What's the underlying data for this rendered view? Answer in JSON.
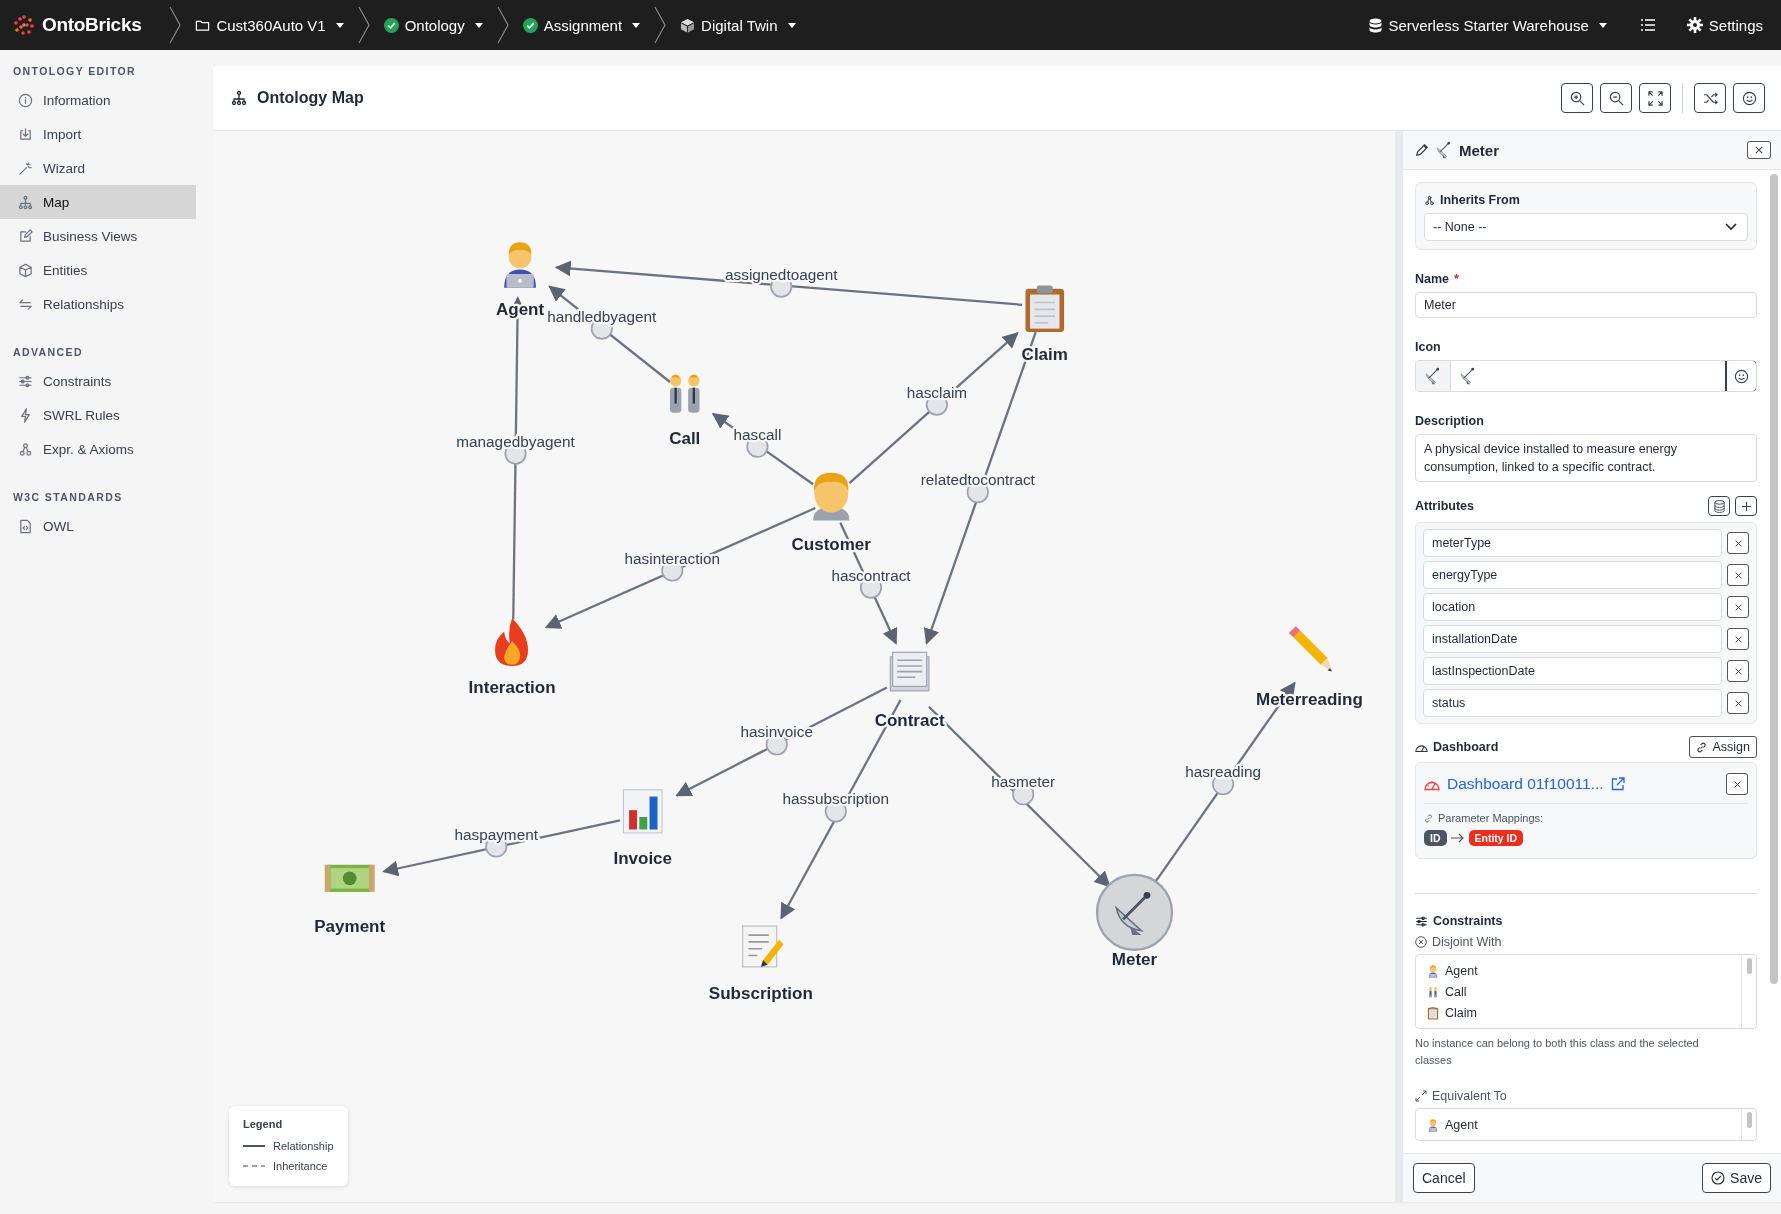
{
  "topbar": {
    "brand": "OntoBricks",
    "breadcrumbs": [
      {
        "label": "Cust360Auto V1",
        "kind": "folder"
      },
      {
        "label": "Ontology",
        "kind": "check"
      },
      {
        "label": "Assignment",
        "kind": "check"
      },
      {
        "label": "Digital Twin",
        "kind": "cube"
      }
    ],
    "warehouse": "Serverless Starter Warehouse",
    "settings": "Settings"
  },
  "sidebar": {
    "sections": [
      {
        "title": "ONTOLOGY EDITOR",
        "items": [
          {
            "label": "Information",
            "kind": "info",
            "selected": false
          },
          {
            "label": "Import",
            "kind": "import",
            "selected": false
          },
          {
            "label": "Wizard",
            "kind": "wand",
            "selected": false
          },
          {
            "label": "Map",
            "kind": "tree",
            "selected": true
          },
          {
            "label": "Business Views",
            "kind": "edit",
            "selected": false
          },
          {
            "label": "Entities",
            "kind": "cube",
            "selected": false
          },
          {
            "label": "Relationships",
            "kind": "arrows",
            "selected": false
          }
        ]
      },
      {
        "title": "ADVANCED",
        "items": [
          {
            "label": "Constraints",
            "kind": "sliders",
            "selected": false
          },
          {
            "label": "SWRL Rules",
            "kind": "bolt",
            "selected": false
          },
          {
            "label": "Expr. & Axioms",
            "kind": "nodes",
            "selected": false
          }
        ]
      },
      {
        "title": "W3C STANDARDS",
        "items": [
          {
            "label": "OWL",
            "kind": "file",
            "selected": false
          }
        ]
      }
    ]
  },
  "map": {
    "title": "Ontology Map",
    "nodes": [
      {
        "label": "Agent",
        "selected": false
      },
      {
        "label": "Call",
        "selected": false
      },
      {
        "label": "Claim",
        "selected": false
      },
      {
        "label": "Customer",
        "selected": false
      },
      {
        "label": "Interaction",
        "selected": false
      },
      {
        "label": "Contract",
        "selected": false
      },
      {
        "label": "Meterreading",
        "selected": false
      },
      {
        "label": "Invoice",
        "selected": false
      },
      {
        "label": "Payment",
        "selected": false
      },
      {
        "label": "Subscription",
        "selected": false
      },
      {
        "label": "Meter",
        "selected": true
      }
    ],
    "edges": [
      {
        "label": "assignedtoagent"
      },
      {
        "label": "handledbyagent"
      },
      {
        "label": "managedbyagent"
      },
      {
        "label": "hascall"
      },
      {
        "label": "hasclaim"
      },
      {
        "label": "relatedtocontract"
      },
      {
        "label": "hasinteraction"
      },
      {
        "label": "hascontract"
      },
      {
        "label": "hasinvoice"
      },
      {
        "label": "hassubscription"
      },
      {
        "label": "hasmeter"
      },
      {
        "label": "hasreading"
      },
      {
        "label": "haspayment"
      }
    ],
    "legend": {
      "title": "Legend",
      "items": [
        {
          "label": "Relationship",
          "kind": "solid"
        },
        {
          "label": "Inheritance",
          "kind": "dashed"
        }
      ]
    }
  },
  "panel": {
    "title": "Meter",
    "inherits_from": {
      "label": "Inherits From",
      "value": "-- None --"
    },
    "name": {
      "label": "Name",
      "required_mark": "*",
      "value": "Meter"
    },
    "icon": {
      "label": "Icon"
    },
    "description": {
      "label": "Description",
      "value": "A physical device installed to measure energy consumption, linked to a specific contract."
    },
    "attributes": {
      "label": "Attributes",
      "items": [
        "meterType",
        "energyType",
        "location",
        "installationDate",
        "lastInspectionDate",
        "status"
      ]
    },
    "dashboard": {
      "label": "Dashboard",
      "assign": "Assign",
      "link": "Dashboard 01f10011...",
      "mappings_label": "Parameter Mappings:",
      "mapping": {
        "from": "ID",
        "to": "Entity ID"
      }
    },
    "constraints": {
      "title": "Constraints",
      "disjoint_with": {
        "label": "Disjoint With",
        "items": [
          "Agent",
          "Call",
          "Claim"
        ]
      },
      "help": "No instance can belong to both this class and the selected classes",
      "equivalent_to": {
        "label": "Equivalent To",
        "items": [
          "Agent"
        ]
      }
    },
    "buttons": {
      "cancel": "Cancel",
      "save": "Save"
    }
  }
}
